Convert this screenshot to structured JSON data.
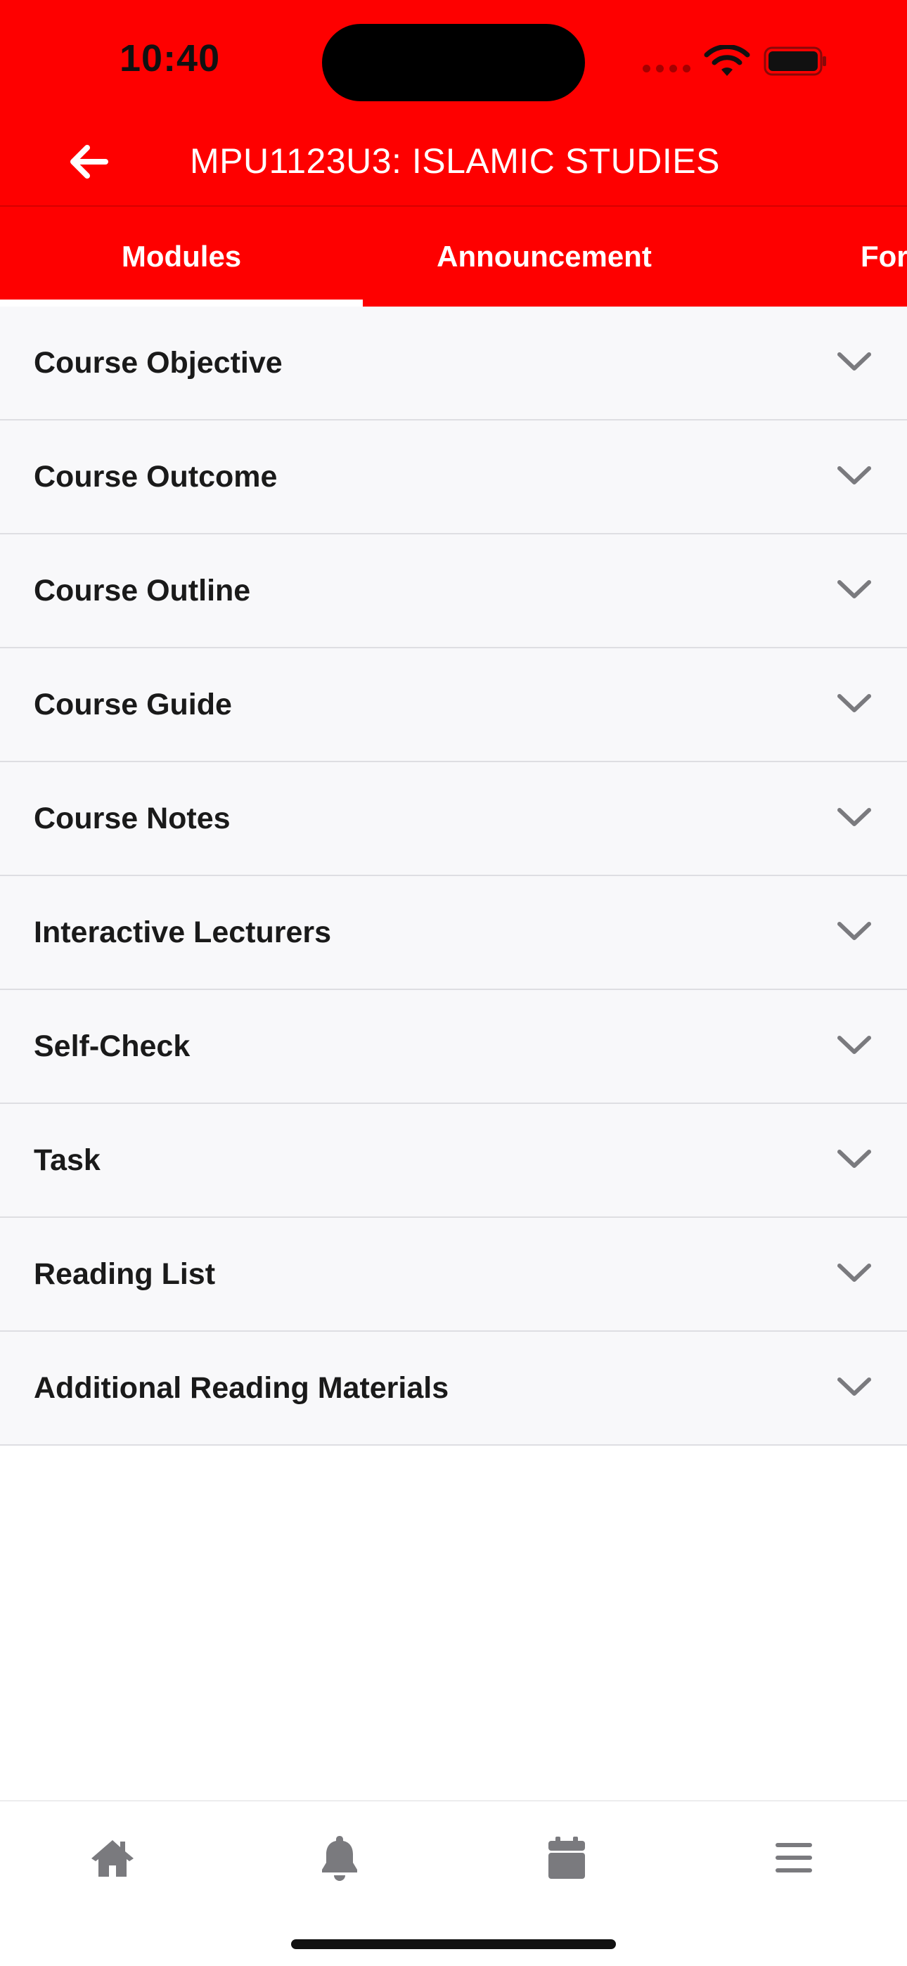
{
  "status_bar": {
    "time": "10:40"
  },
  "header": {
    "title": "MPU1123U3: ISLAMIC STUDIES",
    "back_icon": "arrow-left-icon",
    "background_color": "#fe0000"
  },
  "tabs": [
    {
      "label": "Modules",
      "selected": true
    },
    {
      "label": "Announcement",
      "selected": false
    },
    {
      "label": "For",
      "selected": false
    }
  ],
  "modules": [
    {
      "label": "Course Objective"
    },
    {
      "label": "Course Outcome"
    },
    {
      "label": "Course Outline"
    },
    {
      "label": "Course Guide"
    },
    {
      "label": "Course Notes"
    },
    {
      "label": "Interactive Lecturers"
    },
    {
      "label": "Self-Check"
    },
    {
      "label": "Task"
    },
    {
      "label": "Reading List"
    },
    {
      "label": "Additional Reading Materials"
    }
  ],
  "bottom_nav": [
    {
      "icon": "home-icon"
    },
    {
      "icon": "bell-icon"
    },
    {
      "icon": "calendar-icon"
    },
    {
      "icon": "menu-icon"
    }
  ]
}
